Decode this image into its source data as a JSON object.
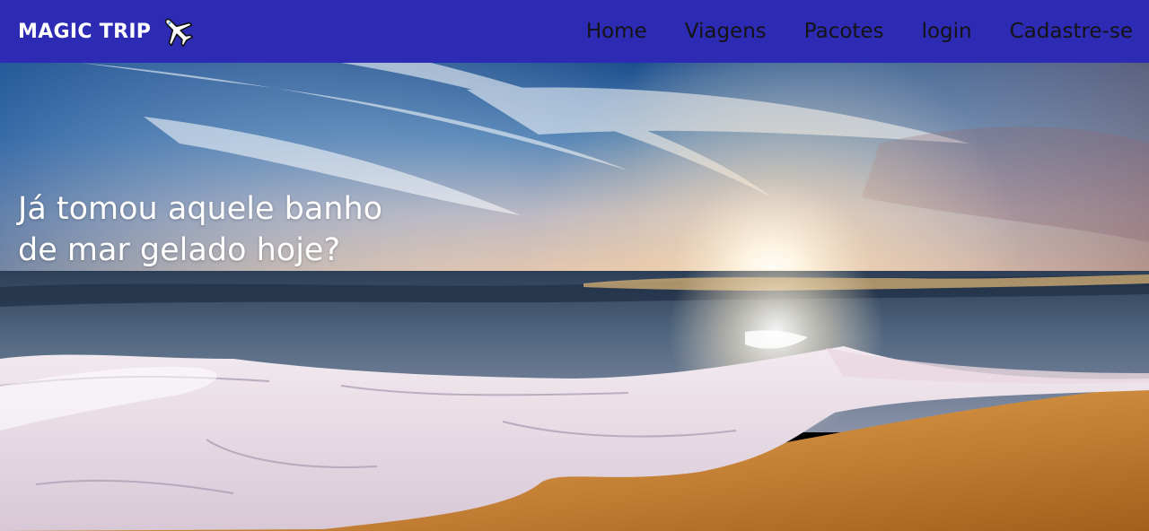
{
  "colors": {
    "navbar_bg": "#2d2ab4",
    "brand_text": "#ffffff",
    "nav_link_text": "#141414",
    "headline_text": "#ffffff"
  },
  "header": {
    "brand": "MAGIC TRIP",
    "brand_icon": "airplane-icon",
    "nav": [
      {
        "label": "Home"
      },
      {
        "label": "Viagens"
      },
      {
        "label": "Pacotes"
      },
      {
        "label": "login"
      },
      {
        "label": "Cadastre-se"
      }
    ]
  },
  "hero": {
    "image": "beach-sunset-photo",
    "headline_line1": "Já tomou aquele banho",
    "headline_line2": "de mar gelado hoje?"
  }
}
